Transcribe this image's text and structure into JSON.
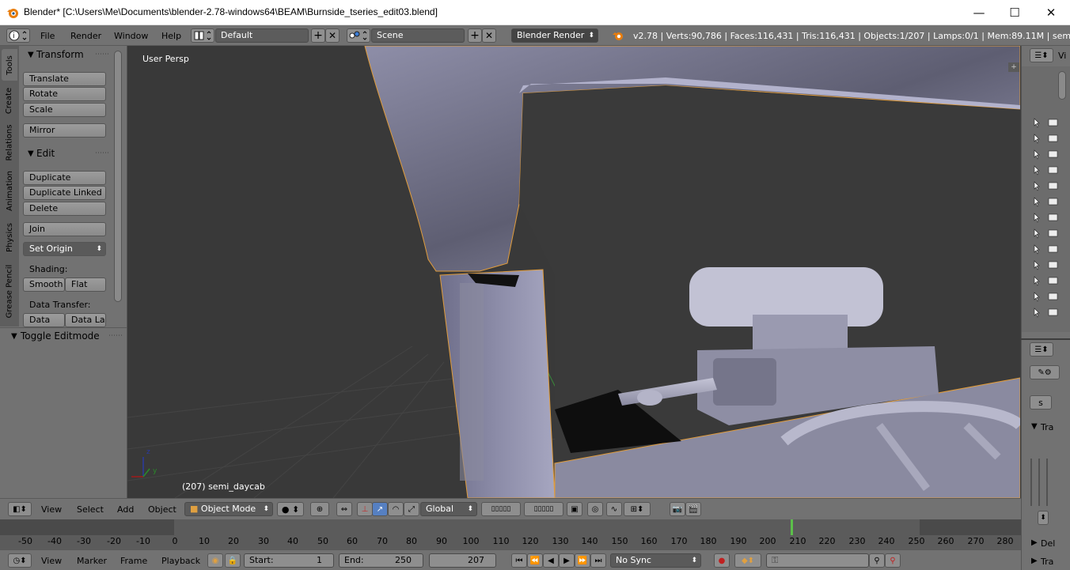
{
  "window": {
    "title": "Blender* [C:\\Users\\Me\\Documents\\blender-2.78-windows64\\BEAM\\Burnside_tseries_edit03.blend]",
    "minimize": "—",
    "maximize": "☐",
    "close": "✕"
  },
  "info_header": {
    "menus": [
      "File",
      "Render",
      "Window",
      "Help"
    ],
    "layout": "Default",
    "scene": "Scene",
    "engine": "Blender Render",
    "stats": "v2.78 | Verts:90,786 | Faces:116,431 | Tris:116,431 | Objects:1/207 | Lamps:0/1 | Mem:89.11M | semi_dayca"
  },
  "tool_shelf": {
    "tabs": [
      "Tools",
      "Create",
      "Relations",
      "Animation",
      "Physics",
      "Grease Pencil"
    ],
    "transform": {
      "title": "Transform",
      "buttons": [
        "Translate",
        "Rotate",
        "Scale",
        "Mirror"
      ]
    },
    "edit": {
      "title": "Edit",
      "buttons": [
        "Duplicate",
        "Duplicate Linked",
        "Delete",
        "Join"
      ],
      "set_origin": "Set Origin",
      "shading_label": "Shading:",
      "smooth": "Smooth",
      "flat": "Flat",
      "data_transfer_label": "Data Transfer:",
      "data": "Data",
      "data_layout": "Data La"
    },
    "toggle_editmode": "Toggle Editmode"
  },
  "viewport": {
    "view_name": "User Persp",
    "object_info": "(207) semi_daycab",
    "axis_z": "z",
    "axis_y": "y"
  },
  "view3d_header": {
    "menus": [
      "View",
      "Select",
      "Add",
      "Object"
    ],
    "mode": "Object Mode",
    "orientation": "Global"
  },
  "timeline": {
    "ticks": [
      "-50",
      "-40",
      "-30",
      "-20",
      "-10",
      "0",
      "10",
      "20",
      "30",
      "40",
      "50",
      "60",
      "70",
      "80",
      "90",
      "100",
      "110",
      "120",
      "130",
      "140",
      "150",
      "160",
      "170",
      "180",
      "190",
      "200",
      "210",
      "220",
      "230",
      "240",
      "250",
      "260",
      "270",
      "280"
    ],
    "current_frame_marker": 207,
    "menus": [
      "View",
      "Marker",
      "Frame",
      "Playback"
    ],
    "start_label": "Start:",
    "start_value": "1",
    "end_label": "End:",
    "end_value": "250",
    "current_frame": "207",
    "sync": "No Sync"
  },
  "right_panel": {
    "outliner_header": "Vi",
    "props_label": "Tra",
    "del_label": "Del",
    "tra_label": "Tra",
    "s_label": "s"
  }
}
